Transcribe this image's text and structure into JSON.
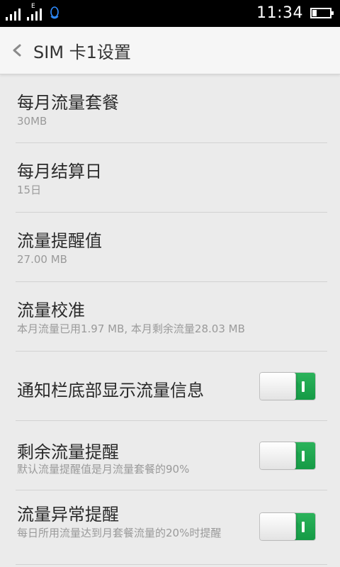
{
  "status_bar": {
    "network_label_1": "",
    "network_label_2": "E",
    "time": "11:34",
    "battery_level": 0.25
  },
  "header": {
    "title": "SIM 卡1设置"
  },
  "settings": [
    {
      "title": "每月流量套餐",
      "subtitle": "30MB"
    },
    {
      "title": "每月结算日",
      "subtitle": "15日"
    },
    {
      "title": "流量提醒值",
      "subtitle": "27.00 MB"
    },
    {
      "title": "流量校准",
      "subtitle": "本月流量已用1.97 MB, 本月剩余流量28.03 MB"
    },
    {
      "title": "通知栏底部显示流量信息",
      "subtitle": "",
      "toggle_on": true
    },
    {
      "title": "剩余流量提醒",
      "subtitle": "默认流量提醒值是月流量套餐的90%",
      "toggle_on": true
    },
    {
      "title": "流量异常提醒",
      "subtitle": "每日所用流量达到月套餐流量的20%时提醒",
      "toggle_on": true
    }
  ],
  "colors": {
    "toggle_on": "#1aa34c",
    "status_bar": "#000000",
    "background": "#ebebeb"
  },
  "icons": {
    "back": "chevron-left-icon",
    "signal": "signal-icon",
    "messenger": "qq-penguin-icon",
    "battery": "battery-icon"
  }
}
